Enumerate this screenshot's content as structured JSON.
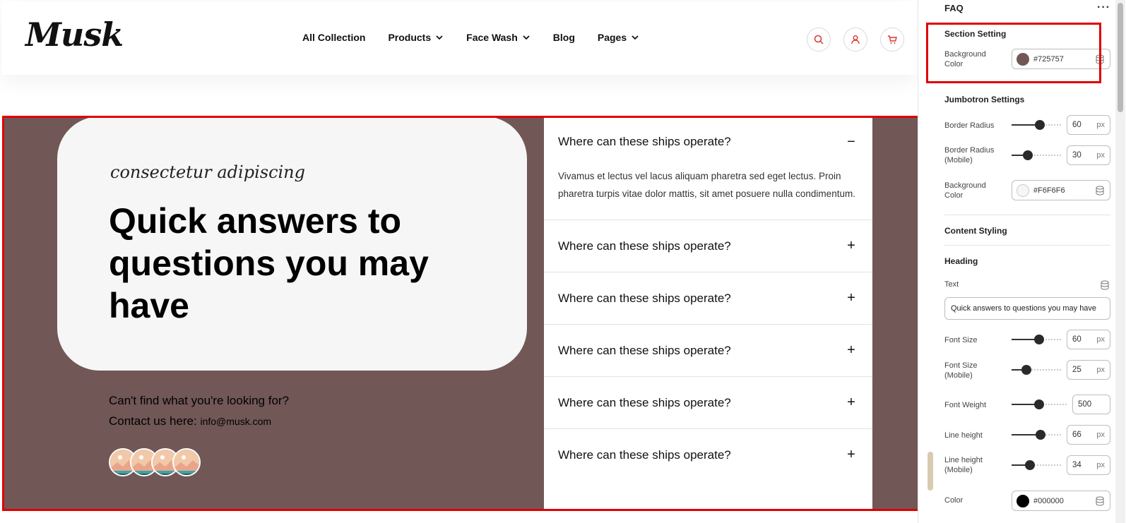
{
  "site": {
    "logo": "Musk",
    "nav": [
      {
        "label": "All Collection",
        "dropdown": false
      },
      {
        "label": "Products",
        "dropdown": true
      },
      {
        "label": "Face Wash",
        "dropdown": true
      },
      {
        "label": "Blog",
        "dropdown": false
      },
      {
        "label": "Pages",
        "dropdown": true
      }
    ],
    "icons": [
      "search-icon",
      "user-icon",
      "cart-icon"
    ]
  },
  "faq_section": {
    "subheading": "consectetur adipiscing",
    "heading": "Quick answers to questions you may have",
    "contact_question": "Can't find what you're looking for?",
    "contact_prefix": "Contact us here: ",
    "contact_email": "info@musk.com",
    "items": [
      {
        "question": "Where can these ships operate?",
        "answer": "Vivamus et lectus vel lacus aliquam pharetra sed eget lectus. Proin pharetra turpis vitae dolor mattis, sit amet posuere nulla condimentum.",
        "open": true,
        "toggle": "−"
      },
      {
        "question": "Where can these ships operate?",
        "open": false,
        "toggle": "+"
      },
      {
        "question": "Where can these ships operate?",
        "open": false,
        "toggle": "+"
      },
      {
        "question": "Where can these ships operate?",
        "open": false,
        "toggle": "+"
      },
      {
        "question": "Where can these ships operate?",
        "open": false,
        "toggle": "+"
      },
      {
        "question": "Where can these ships operate?",
        "open": false,
        "toggle": "+"
      }
    ]
  },
  "panel": {
    "title": "FAQ",
    "more": "···",
    "section_setting": {
      "title": "Section Setting",
      "bg_label": "Background Color",
      "bg_value": "#725757"
    },
    "jumbotron": {
      "title": "Jumbotron Settings",
      "border_radius_label": "Border Radius",
      "border_radius": "60",
      "border_radius_mobile_label": "Border Radius (Mobile)",
      "border_radius_mobile": "30",
      "bg_label": "Background Color",
      "bg_value": "#F6F6F6"
    },
    "content_styling": "Content Styling",
    "heading": {
      "title": "Heading",
      "text_label": "Text",
      "text_value": "Quick answers to questions you may have",
      "font_size_label": "Font Size",
      "font_size": "60",
      "font_size_mobile_label": "Font Size (Mobile)",
      "font_size_mobile": "25",
      "font_weight_label": "Font Weight",
      "font_weight": "500",
      "line_height_label": "Line height",
      "line_height": "66",
      "line_height_mobile_label": "Line height (Mobile)",
      "line_height_mobile": "34",
      "color_label": "Color",
      "color_value": "#000000"
    },
    "unit": "px"
  },
  "colors": {
    "section_bg": "#725757",
    "jumbotron_bg": "#F6F6F6",
    "accent_red": "#e00000",
    "heading_color": "#000000"
  }
}
